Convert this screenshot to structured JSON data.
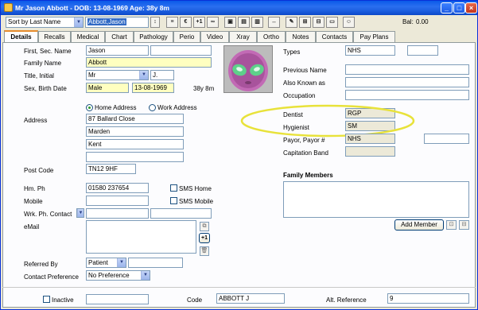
{
  "window": {
    "title": "Mr Jason Abbott - DOB: 13-08-1969 Age: 38y 8m",
    "min": "_",
    "max": "□",
    "close": "×"
  },
  "toolbar": {
    "sort_value": "Sort by Last Name",
    "search_value": "Abbott,Jason",
    "spin": "↕",
    "buttons": [
      "≡",
      "€",
      "+1",
      "∞",
      "▣",
      "▤",
      "▥",
      "↔",
      "✎",
      "⊞",
      "⊟",
      "▭",
      "☺"
    ],
    "bal_label": "Bal:",
    "bal_value": "0.00"
  },
  "tabs": [
    "Details",
    "Recalls",
    "Medical",
    "Chart",
    "Pathology",
    "Perio",
    "Video",
    "Xray",
    "Ortho",
    "Notes",
    "Contacts",
    "Pay Plans"
  ],
  "left": {
    "first_name_label": "First, Sec. Name",
    "first_name": "Jason",
    "second_name": "",
    "family_name_label": "Family Name",
    "family_name": "Abbott",
    "title_label": "Title, Initial",
    "title": "Mr",
    "initial": "J.",
    "sex_label": "Sex, Birth Date",
    "sex": "Male",
    "birth_date": "13-08-1969",
    "age": "38y 8m",
    "home_address": "Home Address",
    "work_address": "Work Address",
    "address_label": "Address",
    "address_lines": [
      "87 Ballard Close",
      "Marden",
      "Kent",
      ""
    ],
    "postcode_label": "Post Code",
    "postcode": "TN12 9HF",
    "hm_ph_label": "Hm. Ph",
    "hm_ph": "01580 237654",
    "sms_home": "SMS Home",
    "mobile_label": "Mobile",
    "mobile": "",
    "sms_mobile": "SMS Mobile",
    "wrk_label": "Wrk. Ph. Contact",
    "email_label": "eMail",
    "email_plus": "+1",
    "referred_label": "Referred By",
    "referred": "Patient",
    "contact_pref_label": "Contact Preference",
    "contact_pref": "No Preference"
  },
  "right": {
    "types_label": "Types",
    "types": "NHS",
    "prev_name_label": "Previous Name",
    "aka_label": "Also Known as",
    "occupation_label": "Occupation",
    "dentist_label": "Dentist",
    "dentist": "RGP",
    "hygienist_label": "Hygienist",
    "hygienist": "SM",
    "payor_label": "Payor, Payor #",
    "payor": "NHS",
    "capitation_label": "Capitation Band",
    "family_label": "Family Members",
    "add_member": "Add Member"
  },
  "footer": {
    "inactive": "Inactive",
    "code_label": "Code",
    "code": "ABBOTT J",
    "alt_ref_label": "Alt. Reference",
    "alt_ref": "9"
  },
  "colors": {
    "titlebar": "#0a5ae8",
    "highlight_yellow": "#ffffc0",
    "ellipse": "#e8e23a"
  }
}
